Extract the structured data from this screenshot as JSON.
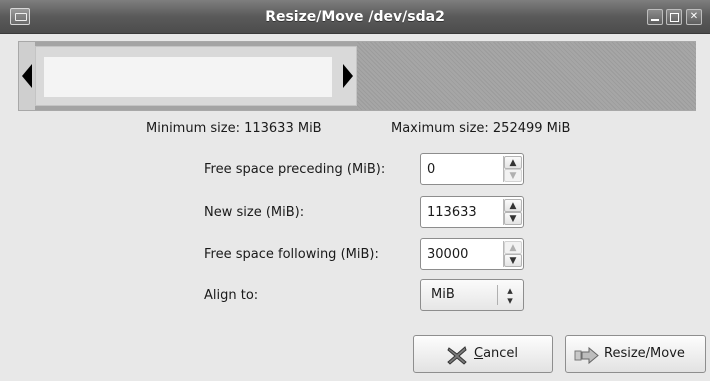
{
  "window": {
    "title": "Resize/Move /dev/sda2",
    "controls": {
      "minimize": "minimize",
      "maximize": "maximize",
      "close": "close"
    }
  },
  "partition_bar": {
    "icons": [
      "resize-handle-left-icon",
      "resize-handle-right-icon"
    ]
  },
  "limits": {
    "minimum": "Minimum size: 113633 MiB",
    "maximum": "Maximum size: 252499 MiB"
  },
  "form": {
    "free_preceding_label": "Free space preceding (MiB):",
    "free_preceding_value": "0",
    "new_size_label": "New size (MiB):",
    "new_size_value": "113633",
    "free_following_label": "Free space following (MiB):",
    "free_following_value": "30000",
    "align_label": "Align to:",
    "align_value": "MiB"
  },
  "buttons": {
    "cancel_label_mnemonic": "C",
    "cancel_label_rest": "ancel",
    "resize_label": "Resize/Move"
  },
  "colors": {
    "titlebar": "#5a5a5a",
    "background": "#e8e8e8",
    "partition_used": "#d9d9d9"
  }
}
